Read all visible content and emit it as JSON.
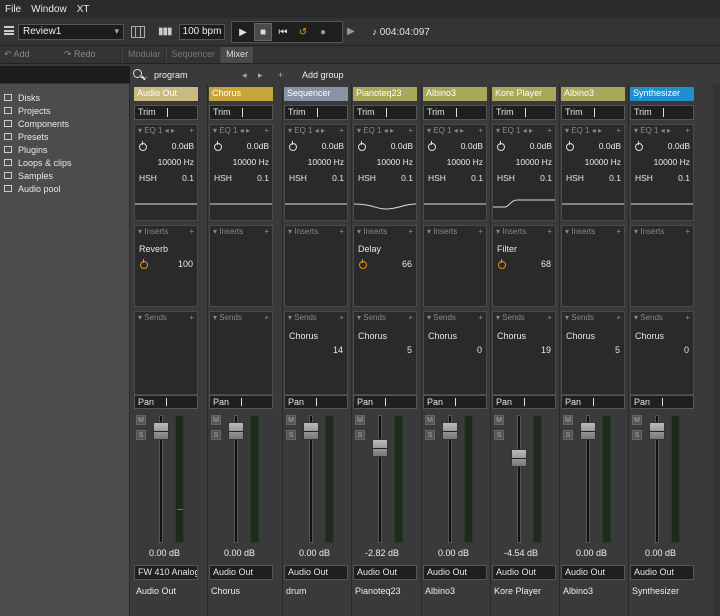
{
  "menu": [
    "File",
    "Window",
    "XT"
  ],
  "toolbar": {
    "project": "Review1",
    "tempo": "100 bpm",
    "time": "004:04:097",
    "add_label": "Add",
    "redo_label": "Redo"
  },
  "tabs": [
    {
      "label": "Modular",
      "selected": false
    },
    {
      "label": "Sequencer",
      "selected": false
    },
    {
      "label": "Mixer",
      "selected": true
    }
  ],
  "sidebar": {
    "items": [
      {
        "label": "Disks",
        "icon": "disk-icon"
      },
      {
        "label": "Projects",
        "icon": "note-icon"
      },
      {
        "label": "Components",
        "icon": "component-icon"
      },
      {
        "label": "Presets",
        "icon": "preset-icon"
      },
      {
        "label": "Plugins",
        "icon": "plugin-icon"
      },
      {
        "label": "Loops & clips",
        "icon": "loop-icon"
      },
      {
        "label": "Samples",
        "icon": "sample-icon"
      },
      {
        "label": "Audio pool",
        "icon": "pool-icon"
      }
    ]
  },
  "mixer_header": {
    "ellipsis": "...",
    "program": "program",
    "add_group": "Add group"
  },
  "labels": {
    "trim": "Trim",
    "eq": "EQ 1",
    "inserts": "Inserts",
    "sends": "Sends",
    "pan": "Pan",
    "mute": "M",
    "solo": "S"
  },
  "strips": [
    {
      "name": "Audio Out",
      "header_color": "#c8ba83",
      "eq_gain": "0.0dB",
      "eq_freq": "10000 Hz",
      "eq_type": "HSH",
      "eq_q": "0.1",
      "insert": "Reverb",
      "insert_value": "100",
      "send": "",
      "send_value": "",
      "db": "0.00 dB",
      "output": "FW 410 Analog",
      "label": "Audio Out",
      "fader_level": 0.93,
      "curve": "flat"
    },
    {
      "name": "Chorus",
      "header_color": "#c8a53a",
      "eq_gain": "0.0dB",
      "eq_freq": "10000 Hz",
      "eq_type": "HSH",
      "eq_q": "0.1",
      "insert": "",
      "insert_value": "",
      "send": "",
      "send_value": "",
      "db": "0.00 dB",
      "output": "Audio Out",
      "label": "Chorus",
      "fader_level": 0.93,
      "curve": "flat"
    },
    {
      "name": "Sequencer",
      "header_color": "#8a93a6",
      "eq_gain": "0.0dB",
      "eq_freq": "10000 Hz",
      "eq_type": "HSH",
      "eq_q": "0.1",
      "insert": "",
      "insert_value": "",
      "send": "Chorus",
      "send_value": "14",
      "db": "0.00 dB",
      "output": "Audio Out",
      "label": "drum",
      "fader_level": 0.93,
      "curve": "flat"
    },
    {
      "name": "Pianoteq23",
      "header_color": "#a6a85a",
      "eq_gain": "0.0dB",
      "eq_freq": "10000 Hz",
      "eq_type": "HSH",
      "eq_q": "0.1",
      "insert": "Delay",
      "insert_value": "66",
      "send": "Chorus",
      "send_value": "5",
      "db": "-2.82 dB",
      "output": "Audio Out",
      "label": "Pianoteq23",
      "fader_level": 0.8,
      "curve": "dip"
    },
    {
      "name": "Albino3",
      "header_color": "#a6a85a",
      "eq_gain": "0.0dB",
      "eq_freq": "10000 Hz",
      "eq_type": "HSH",
      "eq_q": "0.1",
      "insert": "",
      "insert_value": "",
      "send": "Chorus",
      "send_value": "0",
      "db": "0.00 dB",
      "output": "Audio Out",
      "label": "Albino3",
      "fader_level": 0.93,
      "curve": "flat"
    },
    {
      "name": "Kore Player",
      "header_color": "#a6a85a",
      "eq_gain": "0.0dB",
      "eq_freq": "10000 Hz",
      "eq_type": "HSH",
      "eq_q": "0.1",
      "insert": "Filter",
      "insert_value": "68",
      "send": "Chorus",
      "send_value": "19",
      "db": "-4.54 dB",
      "output": "Audio Out",
      "label": "Kore Player",
      "fader_level": 0.72,
      "curve": "step"
    },
    {
      "name": "Albino3",
      "header_color": "#a6a85a",
      "eq_gain": "0.0dB",
      "eq_freq": "10000 Hz",
      "eq_type": "HSH",
      "eq_q": "0.1",
      "insert": "",
      "insert_value": "",
      "send": "Chorus",
      "send_value": "5",
      "db": "0.00 dB",
      "output": "Audio Out",
      "label": "Albino3",
      "fader_level": 0.93,
      "curve": "flat"
    },
    {
      "name": "Synthesizer",
      "header_color": "#1f8fd0",
      "eq_gain": "0.0dB",
      "eq_freq": "10000 Hz",
      "eq_type": "HSH",
      "eq_q": "0.1",
      "insert": "",
      "insert_value": "",
      "send": "Chorus",
      "send_value": "0",
      "db": "0.00 dB",
      "output": "Audio Out",
      "label": "Synthesizer",
      "fader_level": 0.93,
      "curve": "flat"
    }
  ]
}
